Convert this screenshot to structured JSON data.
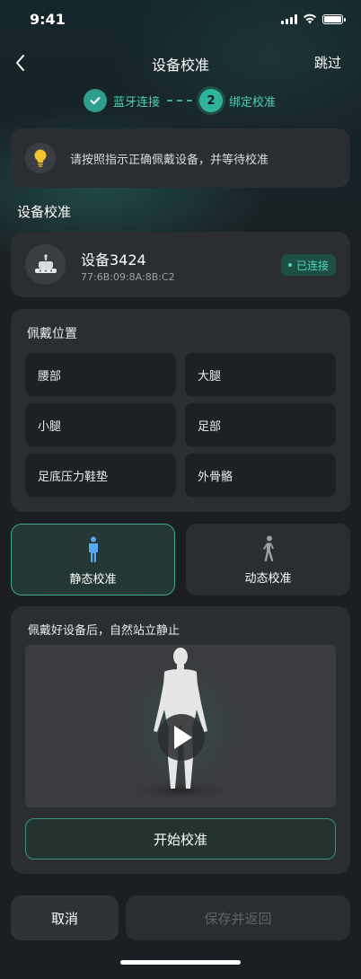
{
  "status_bar": {
    "time": "9:41"
  },
  "nav": {
    "title": "设备校准",
    "skip": "跳过"
  },
  "steps": [
    {
      "label": "蓝牙连接",
      "state": "done"
    },
    {
      "number": "2",
      "label": "绑定校准",
      "state": "active"
    }
  ],
  "tip": {
    "text": "请按照指示正确佩戴设备，并等待校准"
  },
  "section": {
    "title": "设备校准"
  },
  "device": {
    "name": "设备3424",
    "mac": "77:6B:09:8A:8B:C2",
    "status": "已连接"
  },
  "wear": {
    "title": "佩戴位置",
    "options": [
      "腰部",
      "大腿",
      "小腿",
      "足部",
      "足底压力鞋垫",
      "外骨骼"
    ]
  },
  "modes": {
    "static": "静态校准",
    "dynamic": "动态校准",
    "selected": "static"
  },
  "calibration": {
    "instruction": "佩戴好设备后，自然站立静止",
    "start": "开始校准"
  },
  "footer": {
    "cancel": "取消",
    "save": "保存并返回"
  },
  "colors": {
    "accent": "#2fb39d",
    "accent_text": "#4fd6b9",
    "card": "#2a2d32",
    "background": "#1b1e22"
  }
}
